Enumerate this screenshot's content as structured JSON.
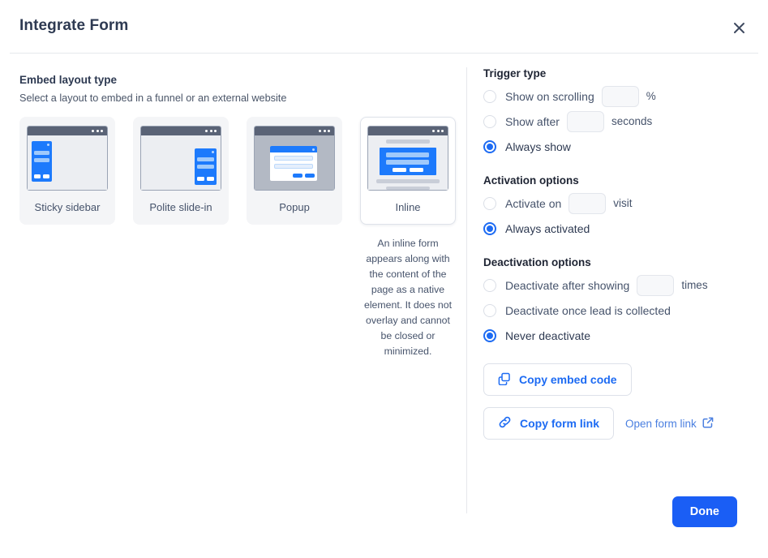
{
  "dialog": {
    "title": "Integrate Form",
    "close_icon": "close-icon"
  },
  "embed": {
    "heading": "Embed layout type",
    "subheading": "Select a layout to embed in a funnel or an external website",
    "options": [
      {
        "label": "Sticky sidebar",
        "selected": false
      },
      {
        "label": "Polite slide-in",
        "selected": false
      },
      {
        "label": "Popup",
        "selected": false
      },
      {
        "label": "Inline",
        "selected": true
      }
    ],
    "selected_description": "An inline form appears along with the content of the page as a native element. It does not overlay and cannot be closed or minimized."
  },
  "trigger": {
    "heading": "Trigger type",
    "options": [
      {
        "label": "Show on scrolling",
        "selected": false,
        "input_value": "",
        "unit": "%"
      },
      {
        "label": "Show after",
        "selected": false,
        "input_value": "",
        "unit": "seconds"
      },
      {
        "label": "Always show",
        "selected": true
      }
    ]
  },
  "activation": {
    "heading": "Activation options",
    "options": [
      {
        "label": "Activate on",
        "selected": false,
        "input_value": "",
        "unit": "visit"
      },
      {
        "label": "Always activated",
        "selected": true
      }
    ]
  },
  "deactivation": {
    "heading": "Deactivation options",
    "options": [
      {
        "label": "Deactivate after showing",
        "selected": false,
        "input_value": "",
        "unit": "times"
      },
      {
        "label": "Deactivate once lead is collected",
        "selected": false
      },
      {
        "label": "Never deactivate",
        "selected": true
      }
    ]
  },
  "actions": {
    "copy_embed_label": "Copy embed code",
    "copy_embed_icon": "copy-icon",
    "copy_link_label": "Copy form link",
    "copy_link_icon": "link-icon",
    "open_link_label": "Open form link",
    "open_link_icon": "external-link-icon",
    "done_label": "Done"
  },
  "colors": {
    "accent": "#1d6bf3",
    "primary_button": "#1a5ef5",
    "text": "#46536b",
    "heading": "#2e3a52"
  }
}
